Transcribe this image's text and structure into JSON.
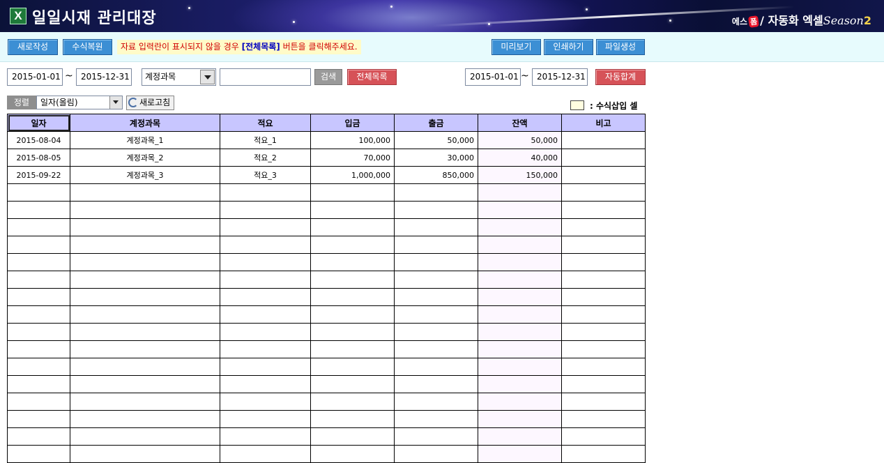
{
  "banner": {
    "title": "일일시재 관리대장",
    "excel_icon": "excel-icon",
    "brand_prefix": "에스",
    "brand_badge": "폼",
    "brand_main": "자동화 엑셀",
    "brand_season": "Season",
    "brand_number": "2"
  },
  "toolbar": {
    "new_label": "새로작성",
    "restore_label": "수식복원",
    "notice_before": "자료 입력란이 표시되지  않을 경우 ",
    "notice_emphasis": "[전체목록]",
    "notice_after": " 버튼을 클릭해주세요.",
    "preview_label": "미리보기",
    "print_label": "인쇄하기",
    "file_label": "파일생성"
  },
  "search": {
    "start_date": "2015-01-01",
    "tilde": "~",
    "end_date": "2015-12-31",
    "field_select": "계정과목",
    "keyword": "",
    "search_label": "검색",
    "all_label": "전체목록",
    "sum_start_date": "2015-01-01",
    "sum_end_date": "2015-12-31",
    "auto_sum_label": "자동합계"
  },
  "sort": {
    "label": "정렬",
    "value": "일자(올림)",
    "refresh_label": "새로고침"
  },
  "legend": {
    "text": ": 수식삽입 셀"
  },
  "table": {
    "headers": [
      "일자",
      "계정과목",
      "적요",
      "입금",
      "출금",
      "잔액",
      "비고"
    ],
    "rows": [
      [
        "2015-08-04",
        "계정과목_1",
        "적요_1",
        "100,000",
        "50,000",
        "50,000",
        ""
      ],
      [
        "2015-08-05",
        "계정과목_2",
        "적요_2",
        "70,000",
        "30,000",
        "40,000",
        ""
      ],
      [
        "2015-09-22",
        "계정과목_3",
        "적요_3",
        "1,000,000",
        "850,000",
        "150,000",
        ""
      ]
    ],
    "empty_rows": 16
  },
  "colors": {
    "header_bg": "#c8c6ff",
    "button_blue": "#3c8fd4",
    "button_red": "#d65258",
    "notice_text": "#d00000",
    "formula_cell": "#fdf7ff"
  }
}
